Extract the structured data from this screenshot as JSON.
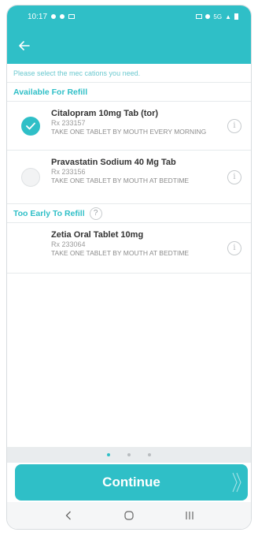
{
  "status_bar": {
    "time": "10:17",
    "network": "5G"
  },
  "instruction": "Please select the mec cations you need.",
  "sections": {
    "available": {
      "title": "Available For Refill"
    },
    "too_early": {
      "title": "Too Early To Refill",
      "help": "?"
    }
  },
  "medications": [
    {
      "name": "Citalopram 10mg Tab (tor)",
      "rx": "Rx 233157",
      "instructions": "TAKE ONE TABLET BY MOUTH EVERY MORNING",
      "selected": true
    },
    {
      "name": "Pravastatin Sodium 40 Mg Tab",
      "rx": "Rx 233156",
      "instructions": "TAKE ONE TABLET BY MOUTH AT BEDTIME",
      "selected": false
    },
    {
      "name": "Zetia Oral Tablet 10mg",
      "rx": "Rx 233064",
      "instructions": "TAKE ONE TABLET BY MOUTH AT BEDTIME",
      "selected": false
    }
  ],
  "info_glyph": "i",
  "pager": {
    "pages": 3,
    "current": 1
  },
  "continue_label": "Continue",
  "colors": {
    "accent": "#2fbfc7",
    "background": "#ffffff"
  },
  "icons": [
    "back-arrow-icon",
    "check-icon",
    "info-icon",
    "help-icon",
    "chevron-double-right-icon",
    "nav-back-icon",
    "nav-home-icon",
    "nav-recents-icon"
  ]
}
